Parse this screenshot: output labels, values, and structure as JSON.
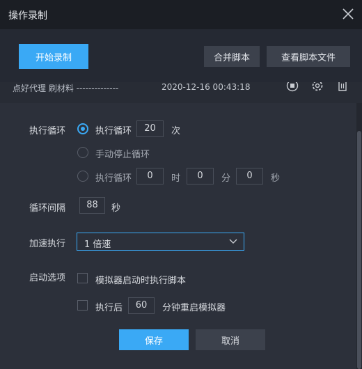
{
  "window": {
    "title": "操作录制"
  },
  "toolbar": {
    "start_record": "开始录制",
    "merge_script": "合并脚本",
    "view_script_file": "查看脚本文件"
  },
  "record": {
    "name": "点好代理 刷材料 --------------",
    "time": "2020-12-16 00:43:18"
  },
  "loop": {
    "label": "执行循环",
    "option_count_label": "执行循环",
    "count": "20",
    "count_unit": "次",
    "option_manual_label": "手动停止循环",
    "option_timed_label": "执行循环",
    "hours": "0",
    "hours_unit": "时",
    "minutes": "0",
    "minutes_unit": "分",
    "seconds": "0",
    "seconds_unit": "秒",
    "selected": "count"
  },
  "interval": {
    "label": "循环间隔",
    "value": "88",
    "unit": "秒"
  },
  "speed": {
    "label": "加速执行",
    "selected": "1 倍速"
  },
  "startup": {
    "label": "启动选项",
    "run_on_start_label": "模拟器启动时执行脚本",
    "run_on_start_checked": false,
    "restart_prefix": "执行后",
    "restart_minutes": "60",
    "restart_suffix": "分钟重启模拟器",
    "restart_checked": false
  },
  "footer": {
    "save": "保存",
    "cancel": "取消"
  },
  "colors": {
    "accent": "#3aa9f5",
    "panel": "#2c303a",
    "background": "#1c1f26"
  }
}
